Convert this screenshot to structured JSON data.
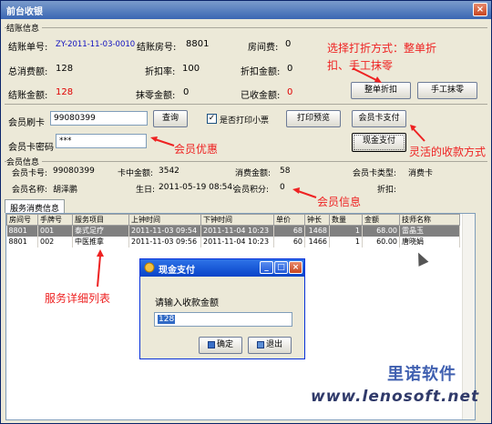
{
  "window": {
    "title": "前台收银",
    "close": "×"
  },
  "settle": {
    "group_label": "结账信息",
    "bill_no_label": "结账单号:",
    "bill_no": "ZY-2011-11-03-0010",
    "room_label": "结账房号:",
    "room": "8801",
    "room_fee_label": "房间费:",
    "room_fee": "0",
    "total_label": "总消费额:",
    "total": "128",
    "discount_rate_label": "折扣率:",
    "discount_rate": "100",
    "discount_amt_label": "折扣金额:",
    "discount_amt": "0",
    "amount_label": "结账金额:",
    "amount": "128",
    "rounding_label": "抹零金额:",
    "rounding": "0",
    "received_label": "已收金额:",
    "received": "0",
    "btn_whole_discount": "整单折扣",
    "btn_manual_round": "手工抹零"
  },
  "card": {
    "swipe_label": "会员刷卡",
    "swipe_value": "99080399",
    "query_btn": "查询",
    "print_receipt_label": "是否打印小票",
    "print_receipt_checked": "✓",
    "preview_btn": "打印预览",
    "card_pay_btn": "会员卡支付",
    "password_label": "会员卡密码",
    "password_value": "***",
    "cash_pay_btn": "现金支付"
  },
  "member": {
    "group_label": "会员信息",
    "card_no_label": "会员卡号:",
    "card_no": "99080399",
    "balance_label": "卡中金额:",
    "balance": "3542",
    "consumed_label": "消费金额:",
    "consumed": "58",
    "type_label": "会员卡类型:",
    "type": "消费卡",
    "name_label": "会员名称:",
    "name": "胡泽鹏",
    "birthday_label": "生日:",
    "birthday": "2011-05-19 08:54:",
    "points_label": "会员积分:",
    "points": "0",
    "discount_label": "折扣:"
  },
  "tab": {
    "label": "服务消费信息"
  },
  "table": {
    "columns": [
      "房间号",
      "手牌号",
      "服务项目",
      "上钟时间",
      "下钟时间",
      "单价",
      "钟长",
      "数量",
      "金额",
      "技师名称"
    ],
    "rows": [
      [
        "8801",
        "001",
        "泰式足疗",
        "2011-11-03 09:54",
        "2011-11-04 10:23",
        "68",
        "1468",
        "1",
        "68.00",
        "雷晶玉"
      ],
      [
        "8801",
        "002",
        "中医推拿",
        "2011-11-03 09:56",
        "2011-11-04 10:23",
        "60",
        "1466",
        "1",
        "60.00",
        "唐晓娟"
      ]
    ]
  },
  "dialog": {
    "title": "现金支付",
    "prompt": "请输入收款金额",
    "value": "128",
    "ok_btn": "确定",
    "exit_btn": "退出"
  },
  "annotations": {
    "discount_modes": "选择打折方式：整单折",
    "discount_modes_2": "扣、手工抹零",
    "member_discount": "会员优惠",
    "flexible_pay": "灵活的收款方式",
    "member_info": "会员信息",
    "service_list": "服务详细列表"
  },
  "watermark": {
    "brand": "里诺软件",
    "url": "www.lenosoft.net"
  },
  "colors": {
    "title_bar": "#3a66b3",
    "annotation": "#ee2222",
    "amount_red": "#e00000",
    "bill_blue": "#1010c0"
  }
}
